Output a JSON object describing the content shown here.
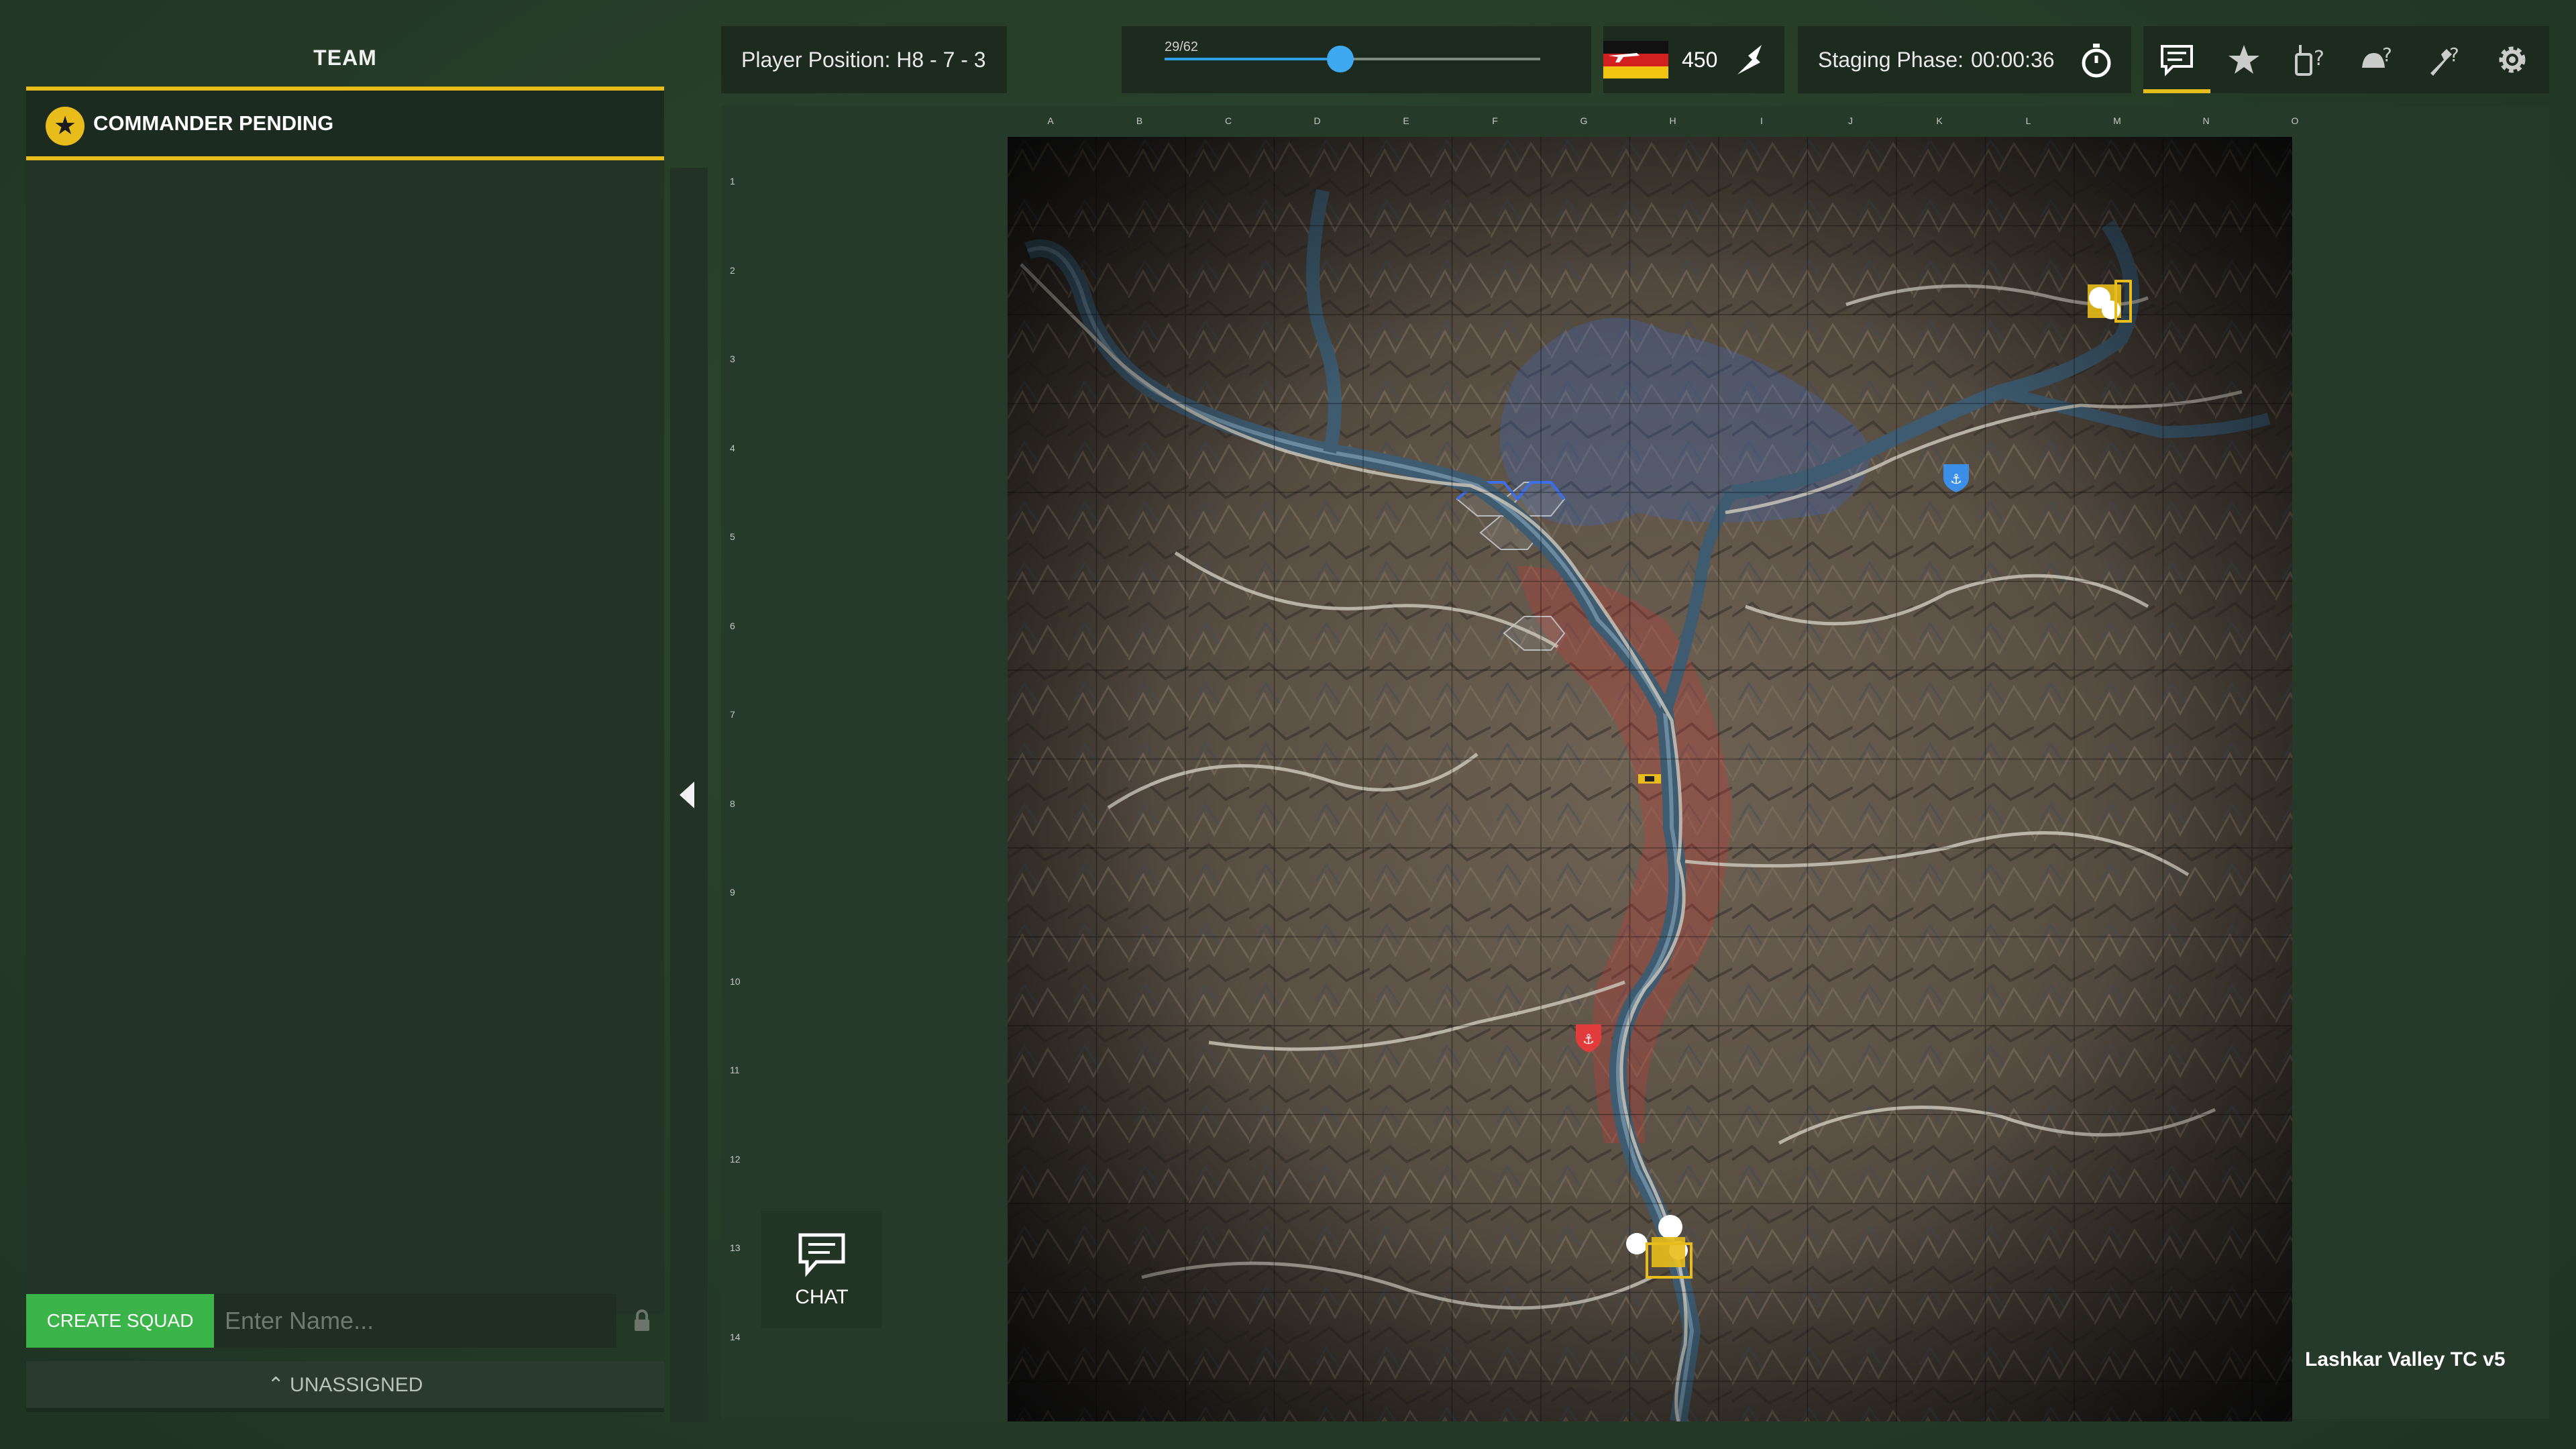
{
  "team_panel": {
    "title": "TEAM",
    "commander_label": "COMMANDER PENDING",
    "create_squad_label": "CREATE SQUAD",
    "squad_name_placeholder": "Enter Name...",
    "unassigned_label": "UNASSIGNED"
  },
  "top_bar": {
    "player_position": "Player Position: H8 - 7 - 3",
    "players_count": "29/62",
    "players_fraction": 0.468,
    "tickets": "450",
    "staging_label": "Staging Phase:",
    "staging_time": "00:00:36",
    "icons": [
      "chat-bubble-icon",
      "star-icon",
      "radio-help-icon",
      "helmet-help-icon",
      "wrench-help-icon",
      "gear-icon"
    ],
    "active_tab": "chat-bubble-icon",
    "accent_color": "#e8bc1a"
  },
  "map": {
    "name": "Lashkar Valley TC v5",
    "columns": [
      "A",
      "B",
      "C",
      "D",
      "E",
      "F",
      "G",
      "H",
      "I",
      "J",
      "K",
      "L",
      "M",
      "N",
      "O"
    ],
    "rows": [
      "1",
      "2",
      "3",
      "4",
      "5",
      "6",
      "7",
      "8",
      "9",
      "10",
      "11",
      "12",
      "13",
      "14"
    ],
    "blue_team_color": "#3b8fe8",
    "red_team_color": "#e23b3b"
  },
  "chat_button": {
    "label": "CHAT"
  }
}
